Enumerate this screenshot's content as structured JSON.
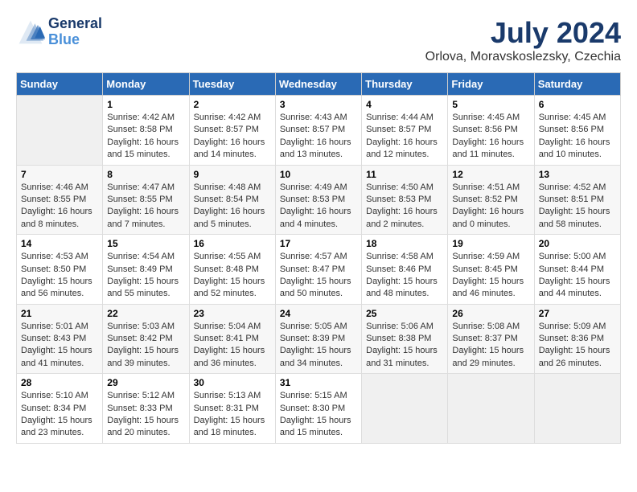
{
  "logo": {
    "line1": "General",
    "line2": "Blue"
  },
  "title": "July 2024",
  "subtitle": "Orlova, Moravskoslezsky, Czechia",
  "days_header": [
    "Sunday",
    "Monday",
    "Tuesday",
    "Wednesday",
    "Thursday",
    "Friday",
    "Saturday"
  ],
  "weeks": [
    [
      {
        "num": "",
        "info": ""
      },
      {
        "num": "1",
        "info": "Sunrise: 4:42 AM\nSunset: 8:58 PM\nDaylight: 16 hours\nand 15 minutes."
      },
      {
        "num": "2",
        "info": "Sunrise: 4:42 AM\nSunset: 8:57 PM\nDaylight: 16 hours\nand 14 minutes."
      },
      {
        "num": "3",
        "info": "Sunrise: 4:43 AM\nSunset: 8:57 PM\nDaylight: 16 hours\nand 13 minutes."
      },
      {
        "num": "4",
        "info": "Sunrise: 4:44 AM\nSunset: 8:57 PM\nDaylight: 16 hours\nand 12 minutes."
      },
      {
        "num": "5",
        "info": "Sunrise: 4:45 AM\nSunset: 8:56 PM\nDaylight: 16 hours\nand 11 minutes."
      },
      {
        "num": "6",
        "info": "Sunrise: 4:45 AM\nSunset: 8:56 PM\nDaylight: 16 hours\nand 10 minutes."
      }
    ],
    [
      {
        "num": "7",
        "info": "Sunrise: 4:46 AM\nSunset: 8:55 PM\nDaylight: 16 hours\nand 8 minutes."
      },
      {
        "num": "8",
        "info": "Sunrise: 4:47 AM\nSunset: 8:55 PM\nDaylight: 16 hours\nand 7 minutes."
      },
      {
        "num": "9",
        "info": "Sunrise: 4:48 AM\nSunset: 8:54 PM\nDaylight: 16 hours\nand 5 minutes."
      },
      {
        "num": "10",
        "info": "Sunrise: 4:49 AM\nSunset: 8:53 PM\nDaylight: 16 hours\nand 4 minutes."
      },
      {
        "num": "11",
        "info": "Sunrise: 4:50 AM\nSunset: 8:53 PM\nDaylight: 16 hours\nand 2 minutes."
      },
      {
        "num": "12",
        "info": "Sunrise: 4:51 AM\nSunset: 8:52 PM\nDaylight: 16 hours\nand 0 minutes."
      },
      {
        "num": "13",
        "info": "Sunrise: 4:52 AM\nSunset: 8:51 PM\nDaylight: 15 hours\nand 58 minutes."
      }
    ],
    [
      {
        "num": "14",
        "info": "Sunrise: 4:53 AM\nSunset: 8:50 PM\nDaylight: 15 hours\nand 56 minutes."
      },
      {
        "num": "15",
        "info": "Sunrise: 4:54 AM\nSunset: 8:49 PM\nDaylight: 15 hours\nand 55 minutes."
      },
      {
        "num": "16",
        "info": "Sunrise: 4:55 AM\nSunset: 8:48 PM\nDaylight: 15 hours\nand 52 minutes."
      },
      {
        "num": "17",
        "info": "Sunrise: 4:57 AM\nSunset: 8:47 PM\nDaylight: 15 hours\nand 50 minutes."
      },
      {
        "num": "18",
        "info": "Sunrise: 4:58 AM\nSunset: 8:46 PM\nDaylight: 15 hours\nand 48 minutes."
      },
      {
        "num": "19",
        "info": "Sunrise: 4:59 AM\nSunset: 8:45 PM\nDaylight: 15 hours\nand 46 minutes."
      },
      {
        "num": "20",
        "info": "Sunrise: 5:00 AM\nSunset: 8:44 PM\nDaylight: 15 hours\nand 44 minutes."
      }
    ],
    [
      {
        "num": "21",
        "info": "Sunrise: 5:01 AM\nSunset: 8:43 PM\nDaylight: 15 hours\nand 41 minutes."
      },
      {
        "num": "22",
        "info": "Sunrise: 5:03 AM\nSunset: 8:42 PM\nDaylight: 15 hours\nand 39 minutes."
      },
      {
        "num": "23",
        "info": "Sunrise: 5:04 AM\nSunset: 8:41 PM\nDaylight: 15 hours\nand 36 minutes."
      },
      {
        "num": "24",
        "info": "Sunrise: 5:05 AM\nSunset: 8:39 PM\nDaylight: 15 hours\nand 34 minutes."
      },
      {
        "num": "25",
        "info": "Sunrise: 5:06 AM\nSunset: 8:38 PM\nDaylight: 15 hours\nand 31 minutes."
      },
      {
        "num": "26",
        "info": "Sunrise: 5:08 AM\nSunset: 8:37 PM\nDaylight: 15 hours\nand 29 minutes."
      },
      {
        "num": "27",
        "info": "Sunrise: 5:09 AM\nSunset: 8:36 PM\nDaylight: 15 hours\nand 26 minutes."
      }
    ],
    [
      {
        "num": "28",
        "info": "Sunrise: 5:10 AM\nSunset: 8:34 PM\nDaylight: 15 hours\nand 23 minutes."
      },
      {
        "num": "29",
        "info": "Sunrise: 5:12 AM\nSunset: 8:33 PM\nDaylight: 15 hours\nand 20 minutes."
      },
      {
        "num": "30",
        "info": "Sunrise: 5:13 AM\nSunset: 8:31 PM\nDaylight: 15 hours\nand 18 minutes."
      },
      {
        "num": "31",
        "info": "Sunrise: 5:15 AM\nSunset: 8:30 PM\nDaylight: 15 hours\nand 15 minutes."
      },
      {
        "num": "",
        "info": ""
      },
      {
        "num": "",
        "info": ""
      },
      {
        "num": "",
        "info": ""
      }
    ]
  ]
}
